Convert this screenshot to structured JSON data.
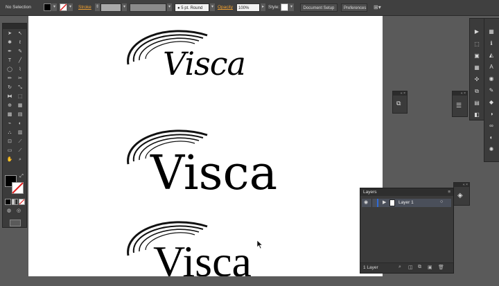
{
  "control_bar": {
    "selection_label": "No Selection",
    "stroke_label": "Stroke",
    "brush_value": "5 pt. Round",
    "opacity_label": "Opacity",
    "opacity_value": "100%",
    "style_label": "Style:",
    "document_setup": "Document Setup",
    "preferences": "Preferences"
  },
  "canvas": {
    "logos": [
      {
        "text": "Visca",
        "style": "script"
      },
      {
        "text": "Visca",
        "style": "slab-serif"
      },
      {
        "text": "Visca",
        "style": "serif"
      }
    ]
  },
  "layers_panel": {
    "title": "Layers",
    "layer_name": "Layer 1",
    "footer_count": "1 Layer"
  },
  "colors": {
    "accent_orange": "#f0a030",
    "panel_dark": "#3b3b3b",
    "artboard": "#ffffff"
  }
}
